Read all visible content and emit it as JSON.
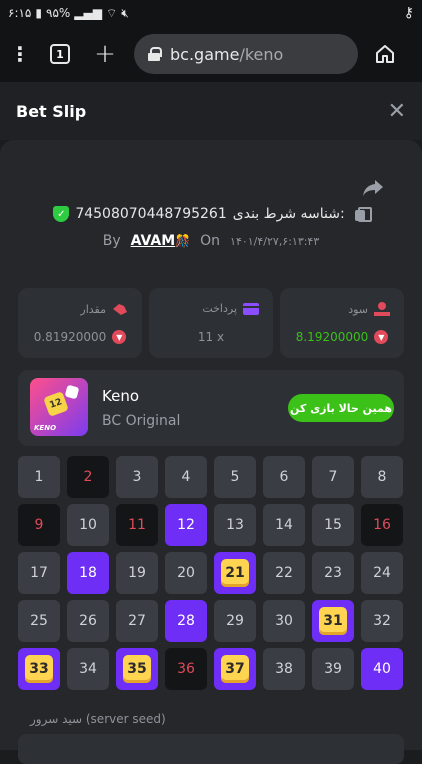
{
  "status_bar": {
    "time": "۶:۱۵",
    "battery": "۹۵%",
    "key_icon": "key-icon"
  },
  "browser": {
    "tab_count": "1",
    "url_host": "bc.game",
    "url_path": "/keno"
  },
  "sheet": {
    "title": "Bet Slip"
  },
  "bet": {
    "id_label": "شناسه شرط بندی:",
    "id_value": "74508070448795261",
    "by_label": "By",
    "user": "AVAM",
    "user_emoji": "🎊",
    "on_label": "On",
    "date": "۱۴۰۱/۴/۲۷,۶:۱۳:۴۳"
  },
  "stats": {
    "amount_label": "مقدار",
    "amount_value": "0.81920000",
    "payout_label": "پرداخت",
    "payout_value": "11 x",
    "profit_label": "سود",
    "profit_value": "8.19200000"
  },
  "game": {
    "name": "Keno",
    "provider": "BC Original",
    "logo_text": "KENO",
    "logo_dice": "12",
    "play_label": "همین حالا بازی کن"
  },
  "grid": [
    {
      "n": "1",
      "s": "normal"
    },
    {
      "n": "2",
      "s": "dark-red"
    },
    {
      "n": "3",
      "s": "normal"
    },
    {
      "n": "4",
      "s": "normal"
    },
    {
      "n": "5",
      "s": "normal"
    },
    {
      "n": "6",
      "s": "normal"
    },
    {
      "n": "7",
      "s": "normal"
    },
    {
      "n": "8",
      "s": "normal"
    },
    {
      "n": "9",
      "s": "dark-red"
    },
    {
      "n": "10",
      "s": "normal"
    },
    {
      "n": "11",
      "s": "dark-red"
    },
    {
      "n": "12",
      "s": "purple"
    },
    {
      "n": "13",
      "s": "normal"
    },
    {
      "n": "14",
      "s": "normal"
    },
    {
      "n": "15",
      "s": "normal"
    },
    {
      "n": "16",
      "s": "dark-red"
    },
    {
      "n": "17",
      "s": "normal"
    },
    {
      "n": "18",
      "s": "purple"
    },
    {
      "n": "19",
      "s": "normal"
    },
    {
      "n": "20",
      "s": "normal"
    },
    {
      "n": "21",
      "s": "hit"
    },
    {
      "n": "22",
      "s": "normal"
    },
    {
      "n": "23",
      "s": "normal"
    },
    {
      "n": "24",
      "s": "normal"
    },
    {
      "n": "25",
      "s": "normal"
    },
    {
      "n": "26",
      "s": "normal"
    },
    {
      "n": "27",
      "s": "normal"
    },
    {
      "n": "28",
      "s": "purple"
    },
    {
      "n": "29",
      "s": "normal"
    },
    {
      "n": "30",
      "s": "normal"
    },
    {
      "n": "31",
      "s": "hit"
    },
    {
      "n": "32",
      "s": "normal"
    },
    {
      "n": "33",
      "s": "hit"
    },
    {
      "n": "34",
      "s": "normal"
    },
    {
      "n": "35",
      "s": "hit"
    },
    {
      "n": "36",
      "s": "dark-red"
    },
    {
      "n": "37",
      "s": "hit"
    },
    {
      "n": "38",
      "s": "normal"
    },
    {
      "n": "39",
      "s": "normal"
    },
    {
      "n": "40",
      "s": "purple"
    }
  ],
  "seed": {
    "label": "سید سرور (server seed)"
  },
  "colors": {
    "accent_green": "#3bc117",
    "accent_purple": "#6e2ef5",
    "hit_yellow": "#ffd451",
    "loss_red": "#e04a5a"
  }
}
